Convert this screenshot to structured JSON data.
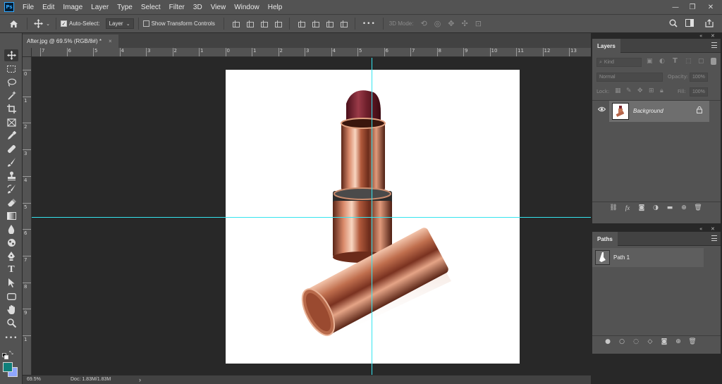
{
  "app": {
    "logo": "Ps"
  },
  "menu": [
    "File",
    "Edit",
    "Image",
    "Layer",
    "Type",
    "Select",
    "Filter",
    "3D",
    "View",
    "Window",
    "Help"
  ],
  "window_controls": {
    "minimize": "—",
    "maximize": "❐",
    "close": "✕"
  },
  "options": {
    "auto_select_label": "Auto-Select:",
    "auto_select_checked": true,
    "auto_select_target": "Layer",
    "show_transform_label": "Show Transform Controls",
    "show_transform_checked": false,
    "more": "•••",
    "mode_3d_label": "3D Mode:"
  },
  "document": {
    "tab_title": "After.jpg @ 69.5% (RGB/8#) *",
    "close": "×"
  },
  "rulers": {
    "top": [
      "7",
      "6",
      "5",
      "4",
      "3",
      "2",
      "1",
      "0",
      "1",
      "2",
      "3",
      "4",
      "5",
      "6",
      "7",
      "8",
      "9",
      "10",
      "11",
      "12",
      "13"
    ],
    "left": [
      "0",
      "1",
      "2",
      "3",
      "4",
      "5",
      "6",
      "7",
      "8",
      "9",
      "1"
    ]
  },
  "status": {
    "zoom": "69.5%",
    "doc_info": "Doc: 1.83M/1.83M",
    "arrow": "›"
  },
  "layers_panel": {
    "title": "Layers",
    "kind_placeholder": "Kind",
    "blend_mode": "Normal",
    "opacity_label": "Opacity:",
    "opacity_value": "100%",
    "lock_label": "Lock:",
    "fill_label": "Fill:",
    "fill_value": "100%",
    "layers": [
      {
        "name": "Background",
        "visible": true,
        "locked": true
      }
    ]
  },
  "paths_panel": {
    "title": "Paths",
    "paths": [
      {
        "name": "Path 1"
      }
    ]
  },
  "colors": {
    "foreground": "#0f7f7a",
    "background": "#8fa6ff",
    "guide": "#35e5ef"
  }
}
